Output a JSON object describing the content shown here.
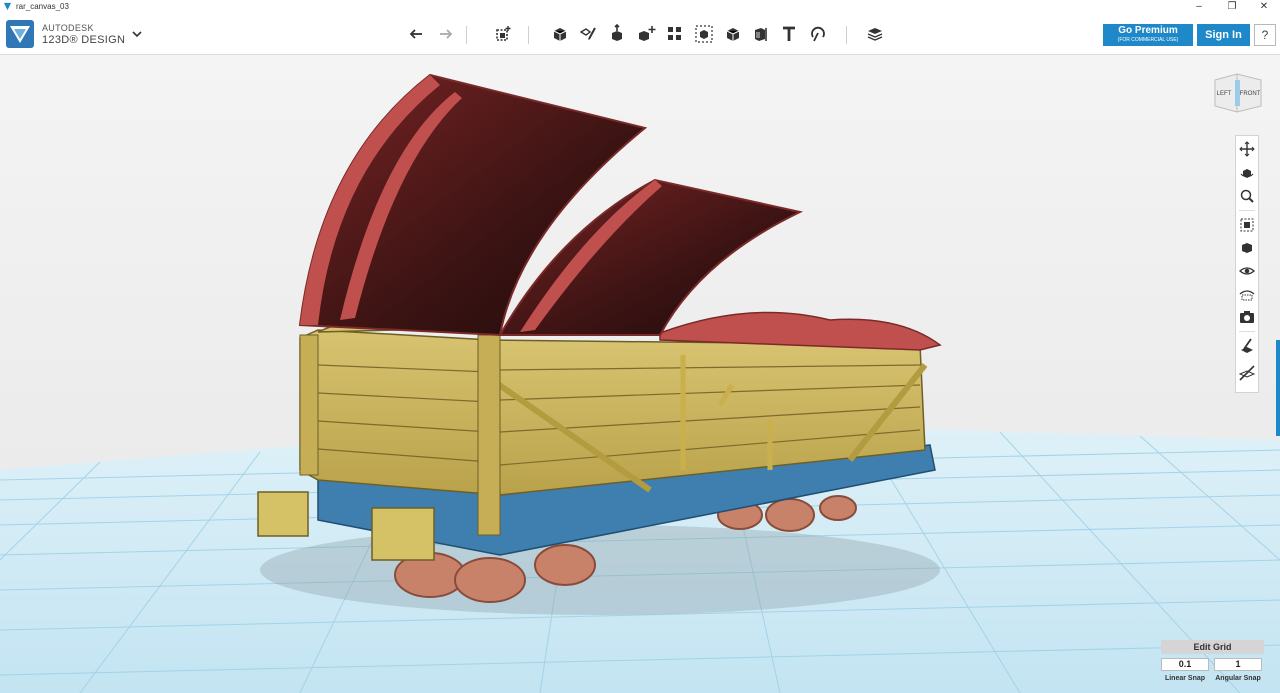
{
  "window": {
    "title": "rar_canvas_03",
    "controls": {
      "minimize": "–",
      "maximize": "❐",
      "close": "✕"
    }
  },
  "brand": {
    "company": "AUTODESK",
    "product": "123D® DESIGN"
  },
  "toolbar": {
    "tools": [
      "undo-icon",
      "redo-icon",
      "transform-icon",
      "primitives-icon",
      "sketch-icon",
      "construct-icon",
      "modify-icon",
      "pattern-icon",
      "grouping-icon",
      "combine-icon",
      "measure-icon",
      "text-icon",
      "snap-icon",
      "materials-icon"
    ]
  },
  "account": {
    "premium_label": "Go Premium",
    "premium_sub": "(FOR COMMERCIAL USE)",
    "signin_label": "Sign In",
    "help_label": "?"
  },
  "viewcube": {
    "left_face": "LEFT",
    "front_face": "FRONT"
  },
  "navbar": {
    "buttons": [
      "pan-icon",
      "orbit-icon",
      "zoom-icon",
      "fit-icon",
      "view-icon",
      "visibility-icon",
      "materials-outlines-icon",
      "camera-icon",
      "screenshot-icon",
      "grid-toggle-icon"
    ]
  },
  "grid": {
    "edit_label": "Edit Grid",
    "linear_snap_value": "0.1",
    "angular_snap_value": "1",
    "linear_snap_label": "Linear Snap",
    "angular_snap_label": "Angular Snap"
  },
  "colors": {
    "accent": "#1e88c8",
    "wagon_body": "#c9b55c",
    "wagon_chassis": "#3f7fb0",
    "lid": "#c0504d",
    "grid_floor": "#cfe8f3",
    "grid_lines": "#8ec9e6"
  }
}
